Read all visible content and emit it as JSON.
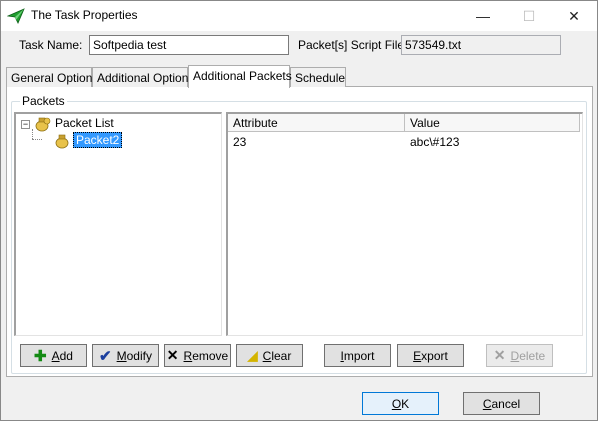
{
  "window": {
    "title": "The Task Properties",
    "controls": {
      "minimize": "—",
      "maximize": "☐",
      "close": "✕"
    }
  },
  "fields": {
    "task_name_label": "Task Name:",
    "task_name_value": "Softpedia test",
    "script_file_label": "Packet[s] Script File:",
    "script_file_value": "573549.txt"
  },
  "tabs": [
    {
      "label": "General Options"
    },
    {
      "label": "Additional Options"
    },
    {
      "label": "Additional Packets",
      "active": true
    },
    {
      "label": "Schedule"
    }
  ],
  "packets": {
    "group_label": "Packets",
    "tree": {
      "expander": "−",
      "root_label": "Packet List",
      "child_label": "Packet2"
    },
    "list": {
      "columns": [
        "Attribute",
        "Value"
      ],
      "rows": [
        {
          "attribute": "23",
          "value": "abc\\#123"
        }
      ]
    }
  },
  "buttons": {
    "add": {
      "prefix": "",
      "hot": "A",
      "rest": "dd",
      "glyph": "✚"
    },
    "modify": {
      "prefix": "",
      "hot": "M",
      "rest": "odify",
      "glyph": "✔"
    },
    "remove": {
      "prefix": "",
      "hot": "R",
      "rest": "emove",
      "glyph": "✕"
    },
    "clear": {
      "prefix": "",
      "hot": "C",
      "rest": "lear",
      "glyph": "◢"
    },
    "import": {
      "prefix": "",
      "hot": "I",
      "rest": "mport"
    },
    "export": {
      "prefix": "",
      "hot": "E",
      "rest": "xport"
    },
    "delete": {
      "prefix": "",
      "hot": "D",
      "rest": "elete",
      "glyph": "✕"
    },
    "ok": {
      "prefix": "",
      "hot": "O",
      "rest": "K"
    },
    "cancel": {
      "prefix": "",
      "hot": "C",
      "rest": "ancel"
    }
  },
  "colors": {
    "accent": "#0078d7",
    "selection": "#3399ff",
    "add_icon": "#138a13",
    "modify_icon": "#1b3f9e",
    "clear_icon": "#f2d300",
    "app_icon": "#1e9e2e"
  }
}
